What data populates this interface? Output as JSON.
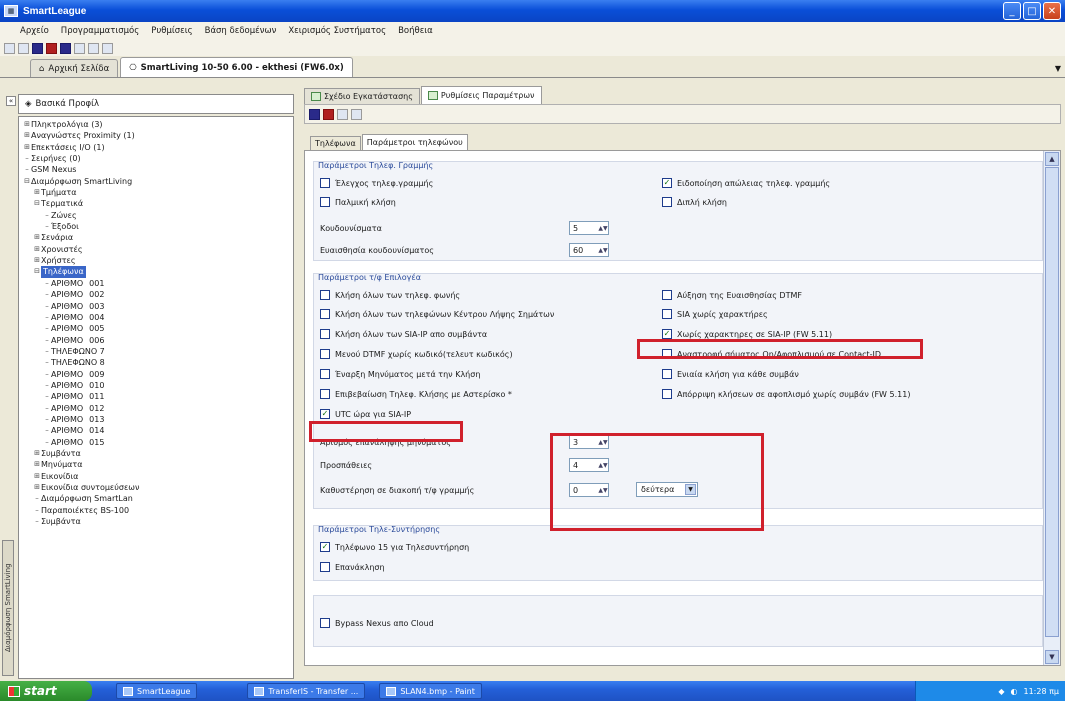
{
  "window": {
    "title": "SmartLeague",
    "app_icon": "app-icon",
    "buttons": [
      "minimize",
      "maximize",
      "close"
    ]
  },
  "menu": [
    "Αρχείο",
    "Προγραμματισμός",
    "Ρυθμίσεις",
    "Βάση δεδομένων",
    "Χειρισμός Συστήματος",
    "Βοήθεια"
  ],
  "doc_tabs": [
    {
      "label": "Αρχική Σελίδα",
      "active": false
    },
    {
      "label": "SmartLiving 10-50 6.00 - ekthesi (FW6.0x)",
      "active": true
    }
  ],
  "left_pane": {
    "header": "Βασικά Προφίλ",
    "vertical_tab": "Διαμόρφωση SmartLiving",
    "tree": [
      {
        "lvl": 0,
        "exp": "+",
        "label": "Πληκτρολόγια (3)"
      },
      {
        "lvl": 0,
        "exp": "+",
        "label": "Αναγνώστες Proximity (1)"
      },
      {
        "lvl": 0,
        "exp": "+",
        "label": "Επεκτάσεις I/O (1)"
      },
      {
        "lvl": 0,
        "exp": "",
        "label": "Σειρήνες (0)"
      },
      {
        "lvl": 0,
        "exp": "",
        "label": "GSM Nexus"
      },
      {
        "lvl": 0,
        "exp": "−",
        "label": "Διαμόρφωση SmartLiving"
      },
      {
        "lvl": 1,
        "exp": "+",
        "label": "Τμήματα"
      },
      {
        "lvl": 1,
        "exp": "−",
        "label": "Τερματικά"
      },
      {
        "lvl": 2,
        "exp": "",
        "label": "Ζώνες"
      },
      {
        "lvl": 2,
        "exp": "",
        "label": "Έξοδοι"
      },
      {
        "lvl": 1,
        "exp": "+",
        "label": "Σενάρια"
      },
      {
        "lvl": 1,
        "exp": "+",
        "label": "Χρονιστές"
      },
      {
        "lvl": 1,
        "exp": "+",
        "label": "Χρήστες"
      },
      {
        "lvl": 1,
        "exp": "−",
        "label": "Τηλέφωνα",
        "selected": true
      },
      {
        "lvl": 2,
        "exp": "",
        "label": "ΑΡΙΘΜΟ",
        "code": "001"
      },
      {
        "lvl": 2,
        "exp": "",
        "label": "ΑΡΙΘΜΟ",
        "code": "002"
      },
      {
        "lvl": 2,
        "exp": "",
        "label": "ΑΡΙΘΜΟ",
        "code": "003"
      },
      {
        "lvl": 2,
        "exp": "",
        "label": "ΑΡΙΘΜΟ",
        "code": "004"
      },
      {
        "lvl": 2,
        "exp": "",
        "label": "ΑΡΙΘΜΟ",
        "code": "005"
      },
      {
        "lvl": 2,
        "exp": "",
        "label": "ΑΡΙΘΜΟ",
        "code": "006"
      },
      {
        "lvl": 2,
        "exp": "",
        "label": "ΤΗΛΕΦΩΝΟ 7"
      },
      {
        "lvl": 2,
        "exp": "",
        "label": "ΤΗΛΕΦΩΝΟ 8"
      },
      {
        "lvl": 2,
        "exp": "",
        "label": "ΑΡΙΘΜΟ",
        "code": "009"
      },
      {
        "lvl": 2,
        "exp": "",
        "label": "ΑΡΙΘΜΟ",
        "code": "010"
      },
      {
        "lvl": 2,
        "exp": "",
        "label": "ΑΡΙΘΜΟ",
        "code": "011"
      },
      {
        "lvl": 2,
        "exp": "",
        "label": "ΑΡΙΘΜΟ",
        "code": "012"
      },
      {
        "lvl": 2,
        "exp": "",
        "label": "ΑΡΙΘΜΟ",
        "code": "013"
      },
      {
        "lvl": 2,
        "exp": "",
        "label": "ΑΡΙΘΜΟ",
        "code": "014"
      },
      {
        "lvl": 2,
        "exp": "",
        "label": "ΑΡΙΘΜΟ",
        "code": "015"
      },
      {
        "lvl": 1,
        "exp": "+",
        "label": "Συμβάντα"
      },
      {
        "lvl": 1,
        "exp": "+",
        "label": "Μηνύματα"
      },
      {
        "lvl": 1,
        "exp": "+",
        "label": "Εικονίδια"
      },
      {
        "lvl": 1,
        "exp": "+",
        "label": "Εικονίδια συντομεύσεων"
      },
      {
        "lvl": 1,
        "exp": "",
        "label": "Διαμόρφωση SmartLan"
      },
      {
        "lvl": 1,
        "exp": "",
        "label": "Παραποιέκτες BS-100"
      },
      {
        "lvl": 1,
        "exp": "",
        "label": "Συμβάντα"
      }
    ]
  },
  "panel_tabs": [
    {
      "label": "Σχέδιο Εγκατάστασης",
      "active": false
    },
    {
      "label": "Ρυθμίσεις Παραμέτρων",
      "active": true
    }
  ],
  "sub_tabs": [
    {
      "label": "Τηλέφωνα",
      "active": false
    },
    {
      "label": "Παράμετροι τηλεφώνου",
      "active": true
    }
  ],
  "groups": {
    "line": {
      "title": "Παράμετροι Τηλεφ. Γραμμής",
      "left": [
        {
          "label": "Έλεγχος τηλεφ.γραμμής",
          "checked": false
        },
        {
          "label": "Παλμική κλήση",
          "checked": false
        }
      ],
      "right": [
        {
          "label": "Ειδοποίηση απώλειας τηλεφ. γραμμής",
          "checked": true
        },
        {
          "label": "Διπλή κλήση",
          "checked": false
        }
      ],
      "rings_label": "Κουδουνίσματα",
      "rings_value": "5",
      "sens_label": "Ευαισθησία κουδουνίσματος",
      "sens_value": "60"
    },
    "dial": {
      "title": "Παράμετροι τ/φ Επιλογέα",
      "left": [
        {
          "label": "Κλήση όλων των τηλεφ. φωνής",
          "checked": false
        },
        {
          "label": "Κλήση όλων των τηλεφώνων Κέντρου Λήψης Σημάτων",
          "checked": false
        },
        {
          "label": "Κλήση όλων των SIA-IP απο συμβάντα",
          "checked": false
        },
        {
          "label": "Μενού DTMF χωρίς κωδικό(τελευτ κωδικός)",
          "checked": false
        },
        {
          "label": "Έναρξη Μηνύματος μετά την Κλήση",
          "checked": false
        },
        {
          "label": "Επιβεβαίωση Τηλεφ. Κλήσης με Αστερίσκο *",
          "checked": false
        },
        {
          "label": "UTC ώρα για SIA-IP",
          "checked": true
        }
      ],
      "right": [
        {
          "label": "Αύξηση της Ευαισθησίας DTMF",
          "checked": false
        },
        {
          "label": "SIA χωρίς χαρακτήρες",
          "checked": false
        },
        {
          "label": "Χωρίς χαρακτηρες σε SIA-IP (FW 5.11)",
          "checked": true
        },
        {
          "label": "Αναστροφή σήματος On/Αφοπλισμού σε Contact-ID",
          "checked": false
        },
        {
          "label": "Ενιαία κλήση για κάθε συμβάν",
          "checked": false
        },
        {
          "label": "Απόρριψη κλήσεων σε αφοπλισμό χωρίς συμβάν (FW 5.11)",
          "checked": false
        }
      ],
      "repeat_label": "Αριθμός επανάληψης μηνύματος",
      "repeat_value": "3",
      "attempts_label": "Προσπάθειες",
      "attempts_value": "4",
      "delay_label": "Καθυστέρηση σε διακοπή τ/φ γραμμής",
      "delay_value": "0",
      "delay_unit": "δεύτερα"
    },
    "maint": {
      "title": "Παράμετροι Τηλε-Συντήρησης",
      "items": [
        {
          "label": "Τηλέφωνο 15 για Τηλεσυντήρηση",
          "checked": true
        },
        {
          "label": "Επανάκληση",
          "checked": false
        }
      ]
    },
    "cloud": {
      "items": [
        {
          "label": "Bypass Nexus απο Cloud",
          "checked": false
        }
      ]
    }
  },
  "taskbar": {
    "start": "start",
    "tasks": [
      "SmartLeague",
      "TransferIS - Transfer ...",
      "SLAN4.bmp - Paint"
    ],
    "clock": "11:28 πμ"
  },
  "colors": {
    "highlight": "#d0202c",
    "title_blue": "#0a4fd8",
    "group_title": "#2a4a9a"
  }
}
